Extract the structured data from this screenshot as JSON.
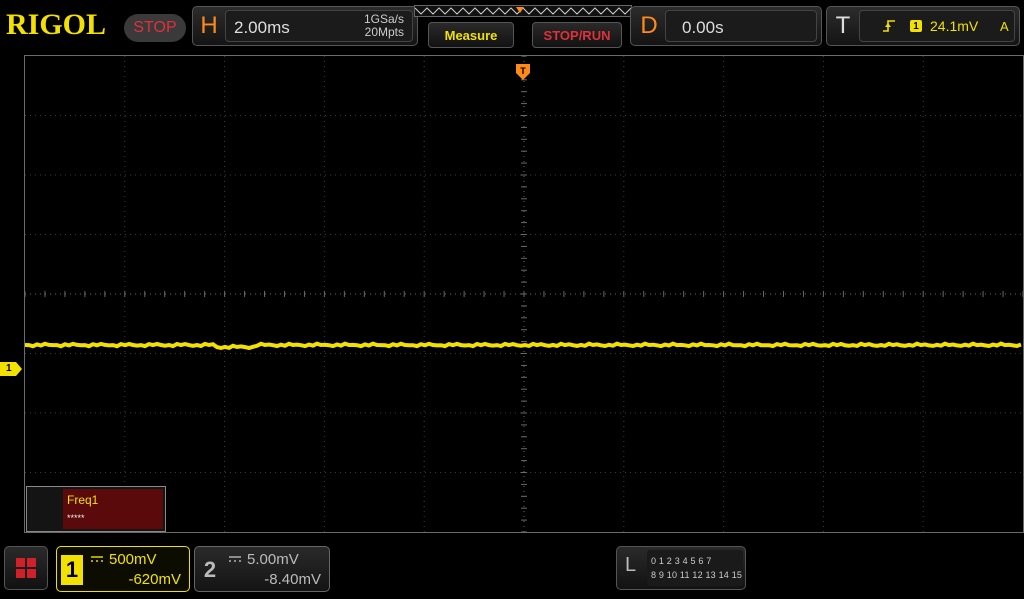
{
  "brand": {
    "logo": "RIGOL",
    "run_state": "STOP"
  },
  "horizontal": {
    "letter": "H",
    "timebase": "2.00ms",
    "sample_rate": "1GSa/s",
    "memory_depth": "20Mpts"
  },
  "toolbar": {
    "measure_label": "Measure",
    "stoprun_label": "STOP/RUN"
  },
  "delay": {
    "letter": "D",
    "value": "0.00s"
  },
  "trigger": {
    "letter": "T",
    "source": "1",
    "level": "24.1mV",
    "mode": "A",
    "edge_icon": "rising-edge-icon"
  },
  "waveform": {
    "channel_marker": "1",
    "trigger_marker_icon": "trigger-position-icon",
    "trace_color": "#f2e100"
  },
  "measurement": {
    "title": "Freq1",
    "value": "*****"
  },
  "channels": {
    "ch1": {
      "num": "1",
      "scale": "500mV",
      "offset": "-620mV",
      "color": "#f2e100"
    },
    "ch2": {
      "num": "2",
      "scale": "5.00mV",
      "offset": "-8.40mV",
      "color": "#bbbbbb"
    }
  },
  "logic": {
    "letter": "L",
    "row1": "0 1 2 3  4 5 6 7",
    "row2": "8 9 10 11 12 13 14 15"
  },
  "colors": {
    "accent_yellow": "#f2e100",
    "accent_orange": "#ff8a1a",
    "stop_red": "#e0303a"
  }
}
